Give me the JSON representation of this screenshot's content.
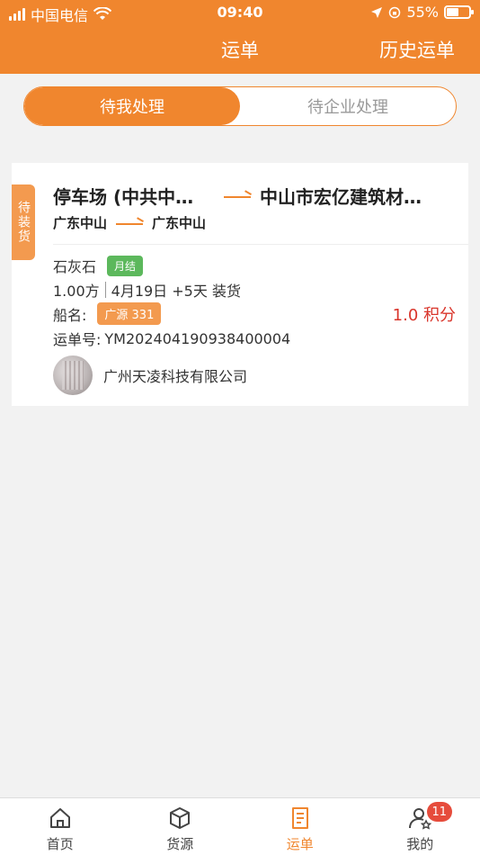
{
  "status_bar": {
    "carrier": "中国电信",
    "time": "09:40",
    "battery": "55%",
    "battery_level": 0.55
  },
  "nav": {
    "title": "运单",
    "right_action": "历史运单"
  },
  "segments": [
    {
      "label": "待我处理",
      "active": true
    },
    {
      "label": "待企业处理",
      "active": false
    }
  ],
  "waybill": {
    "status_tag": "待装货",
    "from_full": "停车场 (中共中…",
    "to_full": "中山市宏亿建筑材…",
    "from_region": "广东中山",
    "to_region": "广东中山",
    "cargo": "石灰石",
    "settlement": "月结",
    "quantity": "1.00方",
    "schedule": "4月19日 +5天 装货",
    "ship_label": "船名:",
    "ship_name": "广源 331",
    "waybill_label": "运单号:",
    "waybill_no": "YM202404190938400004",
    "points": "1.0 积分",
    "company": "广州天凌科技有限公司"
  },
  "tabs": [
    {
      "label": "首页",
      "icon": "home-icon"
    },
    {
      "label": "货源",
      "icon": "box-icon"
    },
    {
      "label": "运单",
      "icon": "waybill-icon"
    },
    {
      "label": "我的",
      "icon": "user-icon",
      "badge": "11"
    }
  ],
  "colors": {
    "accent": "#f0862e",
    "points": "#d9352b",
    "settlement_badge": "#5cb85c"
  }
}
